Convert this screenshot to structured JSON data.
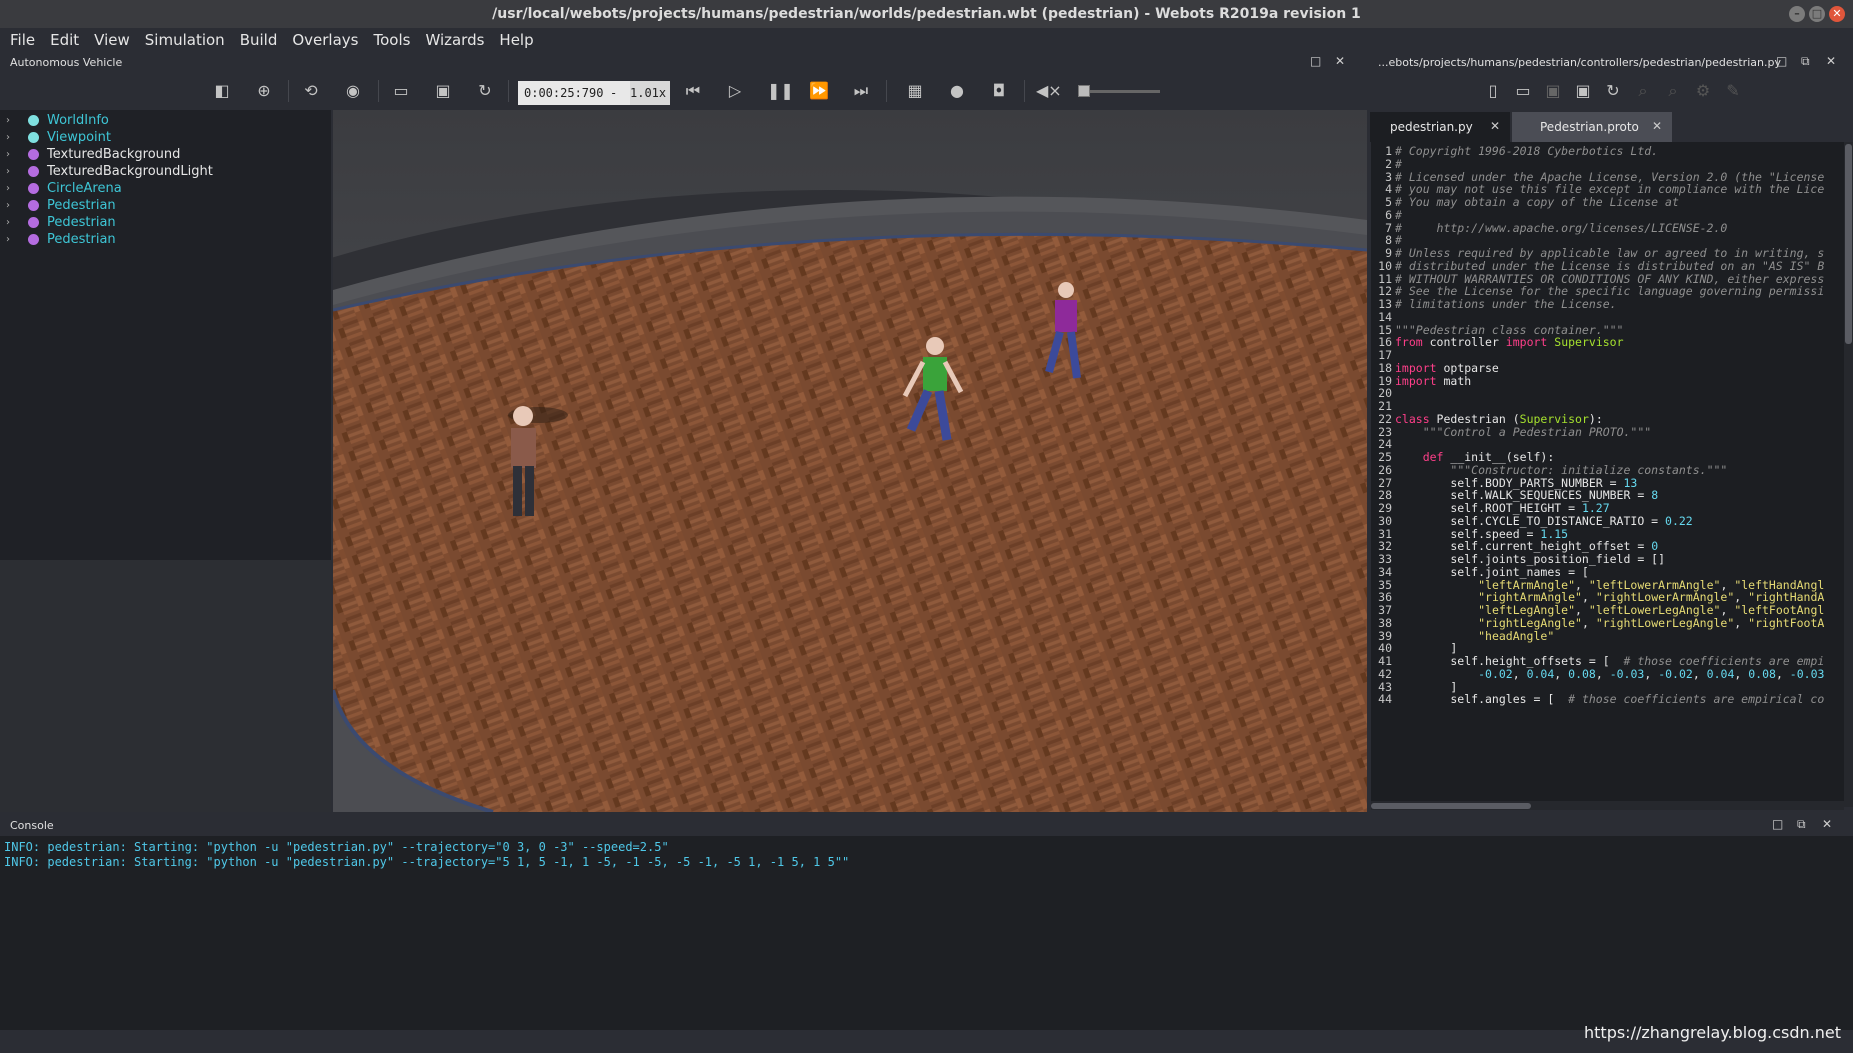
{
  "window": {
    "title": "/usr/local/webots/projects/humans/pedestrian/worlds/pedestrian.wbt (pedestrian) - Webots R2019a revision 1",
    "buttons": [
      "–",
      "□",
      "✕"
    ]
  },
  "menu": [
    {
      "label": "File"
    },
    {
      "label": "Edit"
    },
    {
      "label": "View"
    },
    {
      "label": "Simulation"
    },
    {
      "label": "Build"
    },
    {
      "label": "Overlays"
    },
    {
      "label": "Tools"
    },
    {
      "label": "Wizards"
    },
    {
      "label": "Help"
    }
  ],
  "scene_panel": {
    "title": "Autonomous Vehicle",
    "nodes": [
      {
        "label": "WorldInfo",
        "color": "#3ec6d6",
        "dot": "#7fe0e0"
      },
      {
        "label": "Viewpoint",
        "color": "#3ec6d6",
        "dot": "#7fe0e0"
      },
      {
        "label": "TexturedBackground",
        "color": "#e6e6e6",
        "dot": "#b46ce0"
      },
      {
        "label": "TexturedBackgroundLight",
        "color": "#e6e6e6",
        "dot": "#b46ce0"
      },
      {
        "label": "CircleArena",
        "color": "#3ec6d6",
        "dot": "#b46ce0"
      },
      {
        "label": "Pedestrian",
        "color": "#3ec6d6",
        "dot": "#b46ce0"
      },
      {
        "label": "Pedestrian",
        "color": "#3ec6d6",
        "dot": "#b46ce0"
      },
      {
        "label": "Pedestrian",
        "color": "#3ec6d6",
        "dot": "#b46ce0"
      }
    ]
  },
  "toolbar": {
    "time": "0:00:25:790",
    "separator": "-",
    "speed": "1.01x"
  },
  "editor": {
    "path": "...ebots/projects/humans/pedestrian/controllers/pedestrian/pedestrian.py",
    "tabs": [
      {
        "label": "pedestrian.py",
        "active": true
      },
      {
        "label": "Pedestrian.proto",
        "active": false
      }
    ],
    "lines": [
      [
        [
          "c-com",
          "# Copyright 1996-2018 Cyberbotics Ltd."
        ]
      ],
      [
        [
          "c-com",
          "#"
        ]
      ],
      [
        [
          "c-com",
          "# Licensed under the Apache License, Version 2.0 (the \"License"
        ]
      ],
      [
        [
          "c-com",
          "# you may not use this file except in compliance with the Lice"
        ]
      ],
      [
        [
          "c-com",
          "# You may obtain a copy of the License at"
        ]
      ],
      [
        [
          "c-com",
          "#"
        ]
      ],
      [
        [
          "c-com",
          "#     http://www.apache.org/licenses/LICENSE-2.0"
        ]
      ],
      [
        [
          "c-com",
          "#"
        ]
      ],
      [
        [
          "c-com",
          "# Unless required by applicable law or agreed to in writing, s"
        ]
      ],
      [
        [
          "c-com",
          "# distributed under the License is distributed on an \"AS IS\" B"
        ]
      ],
      [
        [
          "c-com",
          "# WITHOUT WARRANTIES OR CONDITIONS OF ANY KIND, either express"
        ]
      ],
      [
        [
          "c-com",
          "# See the License for the specific language governing permissi"
        ]
      ],
      [
        [
          "c-com",
          "# limitations under the License."
        ]
      ],
      [
        [
          "ct",
          ""
        ]
      ],
      [
        [
          "c-com",
          "\"\"\"Pedestrian class container.\"\"\""
        ]
      ],
      [
        [
          "c-kw",
          "from"
        ],
        [
          "ct",
          " controller "
        ],
        [
          "c-kw",
          "import"
        ],
        [
          "ct",
          " "
        ],
        [
          "c-cls",
          "Supervisor"
        ]
      ],
      [
        [
          "ct",
          ""
        ]
      ],
      [
        [
          "c-kw",
          "import"
        ],
        [
          "ct",
          " optparse"
        ]
      ],
      [
        [
          "c-kw",
          "import"
        ],
        [
          "ct",
          " math"
        ]
      ],
      [
        [
          "ct",
          ""
        ]
      ],
      [
        [
          "ct",
          ""
        ]
      ],
      [
        [
          "c-kw",
          "class"
        ],
        [
          "ct",
          " Pedestrian ("
        ],
        [
          "c-cls",
          "Supervisor"
        ],
        [
          "ct",
          "):"
        ]
      ],
      [
        [
          "ct",
          "    "
        ],
        [
          "c-com",
          "\"\"\"Control a Pedestrian PROTO.\"\"\""
        ]
      ],
      [
        [
          "ct",
          ""
        ]
      ],
      [
        [
          "ct",
          "    "
        ],
        [
          "c-kw",
          "def"
        ],
        [
          "ct",
          " __init__(self):"
        ]
      ],
      [
        [
          "ct",
          "        "
        ],
        [
          "c-com",
          "\"\"\"Constructor: initialize constants.\"\"\""
        ]
      ],
      [
        [
          "ct",
          "        self.BODY_PARTS_NUMBER = "
        ],
        [
          "c-num",
          "13"
        ]
      ],
      [
        [
          "ct",
          "        self.WALK_SEQUENCES_NUMBER = "
        ],
        [
          "c-num",
          "8"
        ]
      ],
      [
        [
          "ct",
          "        self.ROOT_HEIGHT = "
        ],
        [
          "c-num",
          "1.27"
        ]
      ],
      [
        [
          "ct",
          "        self.CYCLE_TO_DISTANCE_RATIO = "
        ],
        [
          "c-num",
          "0.22"
        ]
      ],
      [
        [
          "ct",
          "        self.speed = "
        ],
        [
          "c-num",
          "1.15"
        ]
      ],
      [
        [
          "ct",
          "        self.current_height_offset = "
        ],
        [
          "c-num",
          "0"
        ]
      ],
      [
        [
          "ct",
          "        self.joints_position_field = []"
        ]
      ],
      [
        [
          "ct",
          "        self.joint_names = ["
        ]
      ],
      [
        [
          "ct",
          "            "
        ],
        [
          "c-str",
          "\"leftArmAngle\""
        ],
        [
          "ct",
          ", "
        ],
        [
          "c-str",
          "\"leftLowerArmAngle\""
        ],
        [
          "ct",
          ", "
        ],
        [
          "c-str",
          "\"leftHandAngl"
        ]
      ],
      [
        [
          "ct",
          "            "
        ],
        [
          "c-str",
          "\"rightArmAngle\""
        ],
        [
          "ct",
          ", "
        ],
        [
          "c-str",
          "\"rightLowerArmAngle\""
        ],
        [
          "ct",
          ", "
        ],
        [
          "c-str",
          "\"rightHandA"
        ]
      ],
      [
        [
          "ct",
          "            "
        ],
        [
          "c-str",
          "\"leftLegAngle\""
        ],
        [
          "ct",
          ", "
        ],
        [
          "c-str",
          "\"leftLowerLegAngle\""
        ],
        [
          "ct",
          ", "
        ],
        [
          "c-str",
          "\"leftFootAngl"
        ]
      ],
      [
        [
          "ct",
          "            "
        ],
        [
          "c-str",
          "\"rightLegAngle\""
        ],
        [
          "ct",
          ", "
        ],
        [
          "c-str",
          "\"rightLowerLegAngle\""
        ],
        [
          "ct",
          ", "
        ],
        [
          "c-str",
          "\"rightFootA"
        ]
      ],
      [
        [
          "ct",
          "            "
        ],
        [
          "c-str",
          "\"headAngle\""
        ]
      ],
      [
        [
          "ct",
          "        ]"
        ]
      ],
      [
        [
          "ct",
          "        self.height_offsets = [  "
        ],
        [
          "c-com",
          "# those coefficients are empi"
        ]
      ],
      [
        [
          "ct",
          "            "
        ],
        [
          "c-num",
          "-0.02"
        ],
        [
          "ct",
          ", "
        ],
        [
          "c-num",
          "0.04"
        ],
        [
          "ct",
          ", "
        ],
        [
          "c-num",
          "0.08"
        ],
        [
          "ct",
          ", "
        ],
        [
          "c-num",
          "-0.03"
        ],
        [
          "ct",
          ", "
        ],
        [
          "c-num",
          "-0.02"
        ],
        [
          "ct",
          ", "
        ],
        [
          "c-num",
          "0.04"
        ],
        [
          "ct",
          ", "
        ],
        [
          "c-num",
          "0.08"
        ],
        [
          "ct",
          ", "
        ],
        [
          "c-num",
          "-0.03"
        ]
      ],
      [
        [
          "ct",
          "        ]"
        ]
      ],
      [
        [
          "ct",
          "        self.angles = [  "
        ],
        [
          "c-com",
          "# those coefficients are empirical co"
        ]
      ]
    ]
  },
  "console": {
    "title": "Console",
    "lines": [
      "INFO: pedestrian: Starting: \"python -u \"pedestrian.py\" --trajectory=\"0 3, 0 -3\" --speed=2.5\"",
      "INFO: pedestrian: Starting: \"python -u \"pedestrian.py\" --trajectory=\"5 1, 5 -1, 1 -5, -1 -5, -5 -1, -5 1, -1 5, 1 5\"\""
    ]
  },
  "watermark": "https://zhangrelay.blog.csdn.net",
  "icons": {
    "toolbar": [
      "toggle-scene-tree-icon",
      "add-node-icon",
      "reset-view-icon",
      "eye-icon",
      "open-world-icon",
      "save-world-icon",
      "reload-world-icon",
      "reset-simulation-icon",
      "step-icon",
      "pause-icon",
      "run-icon",
      "fast-icon",
      "record-movie-icon",
      "record-animation-icon",
      "screenshot-icon",
      "mute-icon"
    ],
    "editor": [
      "new-file-icon",
      "open-file-icon",
      "save-file-icon",
      "save-as-icon",
      "revert-icon",
      "find-icon",
      "replace-icon",
      "build-icon",
      "clean-icon"
    ]
  }
}
